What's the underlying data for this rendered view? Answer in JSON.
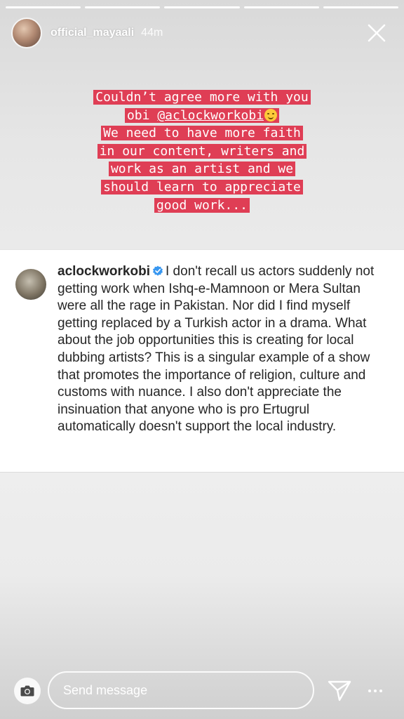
{
  "story": {
    "username": "official_mayaali",
    "time": "44m",
    "segments": 5
  },
  "caption": {
    "line1": "Couldn’t agree more with you",
    "line2_prefix": "obi ",
    "line2_mention": "@aclockworkobi",
    "line3": "We need to have more faith",
    "line4": "in our content, writers and",
    "line5": "work as an artist and we",
    "line6": "should learn to appreciate",
    "line7": "good work..."
  },
  "comment": {
    "username": "aclockworkobi",
    "text": "I don't recall us actors suddenly not getting work when Ishq-e-Mamnoon or Mera Sultan were all the rage in Pakistan. Nor did I find myself getting replaced by a Turkish actor in a drama. What about the job opportunities this is creating for local dubbing artists? This is a singular example of a show that promotes the importance of religion, culture and customs with nuance. I also don't appreciate the insinuation that anyone who is pro Ertugrul automatically doesn't support the local industry."
  },
  "footer": {
    "placeholder": "Send message"
  },
  "colors": {
    "highlight": "#df3e55",
    "verified": "#3897f0"
  },
  "icons": [
    "close-icon",
    "verified-icon",
    "camera-icon",
    "direct-share-icon",
    "more-options-icon",
    "smile-emoji-icon"
  ]
}
